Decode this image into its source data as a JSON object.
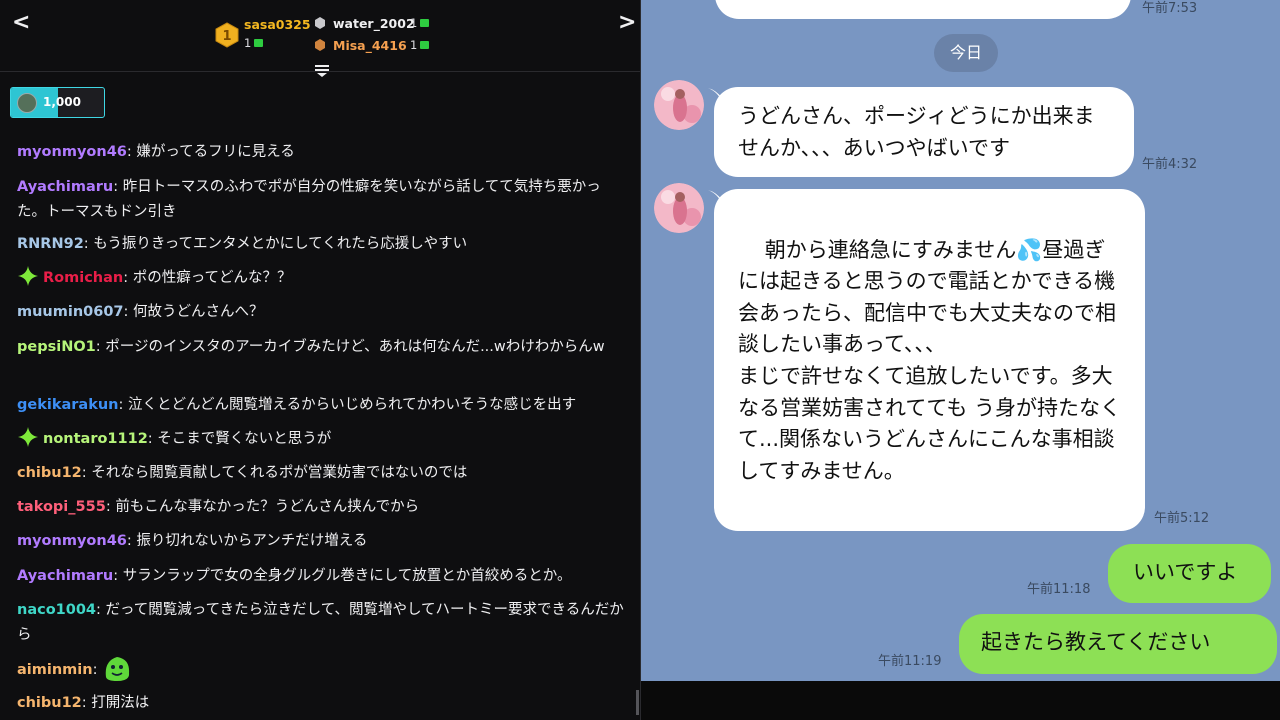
{
  "stream_chat": {
    "leaderboard": {
      "first": {
        "rank": "1",
        "name": "sasa0325",
        "count": "1"
      },
      "second": {
        "name": "water_2002",
        "count": "1"
      },
      "third": {
        "name": "Misa_4416",
        "count": "1"
      }
    },
    "pinned": {
      "amount": "1,000",
      "progress_fraction": 0.5
    },
    "messages": [
      {
        "user": "myonmyon46",
        "color": "#b17bff",
        "text": "嫌がってるフリに見える"
      },
      {
        "user": "Ayachimaru",
        "color": "#b17bff",
        "text": "昨日トーマスのふわでポが自分の性癖を笑いながら話してて気持ち悪かった。トーマスもドン引き"
      },
      {
        "user": "RNRN92",
        "color": "#a7c7e7",
        "text": "もう振りきってエンタメとかにしてくれたら応援しやすい"
      },
      {
        "user": "Romichan",
        "color": "#e91e48",
        "text": "ポの性癖ってどんな？？",
        "badge": "sparkle-badge"
      },
      {
        "user": "muumin0607",
        "color": "#a7c7e7",
        "text": "何故うどんさんへ？"
      },
      {
        "user": "pepsiNO1",
        "color": "#b6f47a",
        "text": "ポージのインスタのアーカイブみたけど、あれは何なんだ...wわけわからんw"
      },
      {
        "user": "gekikarakun",
        "color": "#3d8ff5",
        "text": "泣くとどんどん閲覧増えるからいじめられてかわいそうな感じを出す"
      },
      {
        "user": "nontaro1112",
        "color": "#b6f47a",
        "text": "そこまで賢くないと思うが",
        "badge": "sparkle-badge"
      },
      {
        "user": "chibu12",
        "color": "#f5b56e",
        "text": "それなら閲覧貢献してくれるポが営業妨害ではないのでは"
      },
      {
        "user": "takopi_555",
        "color": "#ff5f7a",
        "text": "前もこんな事なかった？うどんさん挟んでから"
      },
      {
        "user": "myonmyon46",
        "color": "#b17bff",
        "text": "振り切れないからアンチだけ増える"
      },
      {
        "user": "Ayachimaru",
        "color": "#b17bff",
        "text": "サランラップで女の全身グルグル巻きにして放置とか首絞めるとか。"
      },
      {
        "user": "naco1004",
        "color": "#3fd7c8",
        "text": "だって閲覧減ってきたら泣きだして、閲覧増やしてハートミー要求できるんだから"
      },
      {
        "user": "aiminmin",
        "color": "#f5b56e",
        "text": "",
        "emote": "green-blob-emote"
      },
      {
        "user": "chibu12",
        "color": "#f5b56e",
        "text": "打開法は"
      }
    ]
  },
  "line_chat": {
    "top_time": "午前7:53",
    "date_divider": "今日",
    "messages": [
      {
        "from": "other",
        "text": "うどんさん、ポージィどうにか出来ませんか、、、あいつやばいです",
        "time": "午前4:32"
      },
      {
        "from": "other",
        "text": "朝から連絡急にすみません💦昼過ぎには起きると思うので電話とかできる機会あったら、配信中でも大丈夫なので相談したい事あって、、、\nまじで許せなくて追放したいです。多大なる営業妨害されてても う身が持たなくて...関係ないうどんさんにこんな事相談してすみません。",
        "time": "午前5:12"
      },
      {
        "from": "me",
        "text": "いいですよ",
        "time": "午前11:18"
      },
      {
        "from": "me",
        "text": "起きたら教えてください",
        "time": "午前11:19"
      }
    ]
  },
  "colors": {
    "line_background": "#7996c2",
    "my_bubble": "#8de055",
    "chat_background": "#0e0e10",
    "accent_cyan": "#3fd7e4"
  }
}
